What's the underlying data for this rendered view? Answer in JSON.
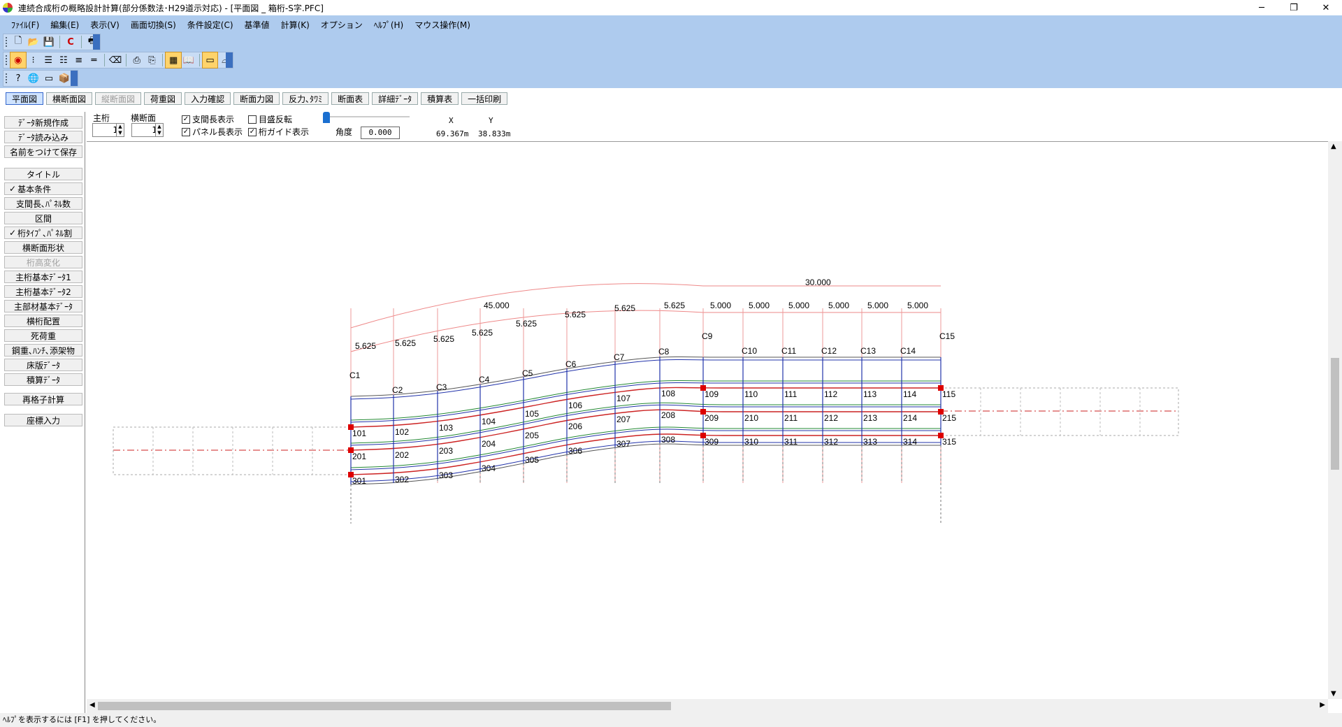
{
  "window": {
    "title": "連続合成桁の概略設計計算(部分係数法･H29道示対応) - [平面図 _ 箱桁-S字.PFC]",
    "min": "─",
    "max": "❐",
    "close": "✕"
  },
  "menu": [
    "ﾌｧｲﾙ(F)",
    "編集(E)",
    "表示(V)",
    "画面切換(S)",
    "条件設定(C)",
    "基準値",
    "計算(K)",
    "オプション",
    "ﾍﾙﾌﾟ(H)",
    "マウス操作(M)"
  ],
  "tabs": [
    {
      "label": "平面図",
      "state": "active"
    },
    {
      "label": "横断面図",
      "state": "normal"
    },
    {
      "label": "縦断面図",
      "state": "disabled"
    },
    {
      "label": "荷重図",
      "state": "normal"
    },
    {
      "label": "入力確認",
      "state": "normal"
    },
    {
      "label": "断面力図",
      "state": "normal"
    },
    {
      "label": "反力､ﾀﾜﾐ",
      "state": "normal"
    },
    {
      "label": "断面表",
      "state": "normal"
    },
    {
      "label": "詳細ﾃﾞｰﾀ",
      "state": "normal"
    },
    {
      "label": "積算表",
      "state": "normal"
    },
    {
      "label": "一括印刷",
      "state": "normal"
    }
  ],
  "left": {
    "file_buttons": [
      "ﾃﾞｰﾀ新規作成",
      "ﾃﾞｰﾀ読み込み",
      "名前をつけて保存"
    ],
    "items": [
      {
        "label": "タイトル",
        "state": "normal"
      },
      {
        "label": "基本条件",
        "state": "checked"
      },
      {
        "label": "支間長､ﾊﾟﾈﾙ数",
        "state": "normal"
      },
      {
        "label": "区間",
        "state": "normal"
      },
      {
        "label": "桁ﾀｲﾌﾟ､ﾊﾟﾈﾙ割",
        "state": "checked"
      },
      {
        "label": "横断面形状",
        "state": "normal"
      },
      {
        "label": "桁高変化",
        "state": "disabled"
      },
      {
        "label": "主桁基本ﾃﾞｰﾀ1",
        "state": "normal"
      },
      {
        "label": "主桁基本ﾃﾞｰﾀ2",
        "state": "normal"
      },
      {
        "label": "主部材基本ﾃﾞｰﾀ",
        "state": "normal"
      },
      {
        "label": "横桁配置",
        "state": "normal"
      },
      {
        "label": "死荷重",
        "state": "normal"
      },
      {
        "label": "鋼重､ﾊﾝﾁ､添架物",
        "state": "normal"
      },
      {
        "label": "床版ﾃﾞｰﾀ",
        "state": "normal"
      },
      {
        "label": "積算ﾃﾞｰﾀ",
        "state": "normal"
      }
    ],
    "recalc": "再格子計算",
    "coord_input": "座標入力"
  },
  "controls": {
    "main_girder_label": "主桁",
    "main_girder_value": "1",
    "cross_label": "横断面",
    "cross_value": "1",
    "chk_span": {
      "label": "支間長表示",
      "checked": true
    },
    "chk_panel": {
      "label": "パネル長表示",
      "checked": true
    },
    "chk_scale": {
      "label": "目盛反転",
      "checked": false
    },
    "chk_guide": {
      "label": "桁ガイド表示",
      "checked": true
    },
    "angle_label": "角度",
    "angle_value": "0.000",
    "x_label": "X",
    "y_label": "Y",
    "x_value": "69.367m",
    "y_value": "38.833m"
  },
  "drawing": {
    "span_top_right": "30.000",
    "span_top_left": "45.000",
    "right_panels": [
      "5.000",
      "5.000",
      "5.000",
      "5.000",
      "5.000",
      "5.000"
    ],
    "left_panels": [
      "5.625",
      "5.625",
      "5.625",
      "5.625",
      "5.625",
      "5.625",
      "5.625",
      "5.625"
    ],
    "cross_beams": [
      "C1",
      "C2",
      "C3",
      "C4",
      "C5",
      "C6",
      "C7",
      "C8",
      "C9",
      "C10",
      "C11",
      "C12",
      "C13",
      "C14",
      "C15"
    ],
    "nodes_g1": [
      "101",
      "102",
      "103",
      "104",
      "105",
      "106",
      "107",
      "108",
      "109",
      "110",
      "111",
      "112",
      "113",
      "114",
      "115"
    ],
    "nodes_g2": [
      "201",
      "202",
      "203",
      "204",
      "205",
      "206",
      "207",
      "208",
      "209",
      "210",
      "211",
      "212",
      "213",
      "214",
      "215"
    ],
    "nodes_g3": [
      "301",
      "302",
      "303",
      "304",
      "305",
      "306",
      "307",
      "308",
      "309",
      "310",
      "311",
      "312",
      "313",
      "314",
      "315"
    ]
  },
  "status": "ﾍﾙﾌﾟを表示するには [F1] を押してください。",
  "colors": {
    "band": "#aecbee",
    "girder": "#cc2222",
    "web": "#2233aa",
    "guide": "#228833",
    "support": "#dd0000"
  }
}
